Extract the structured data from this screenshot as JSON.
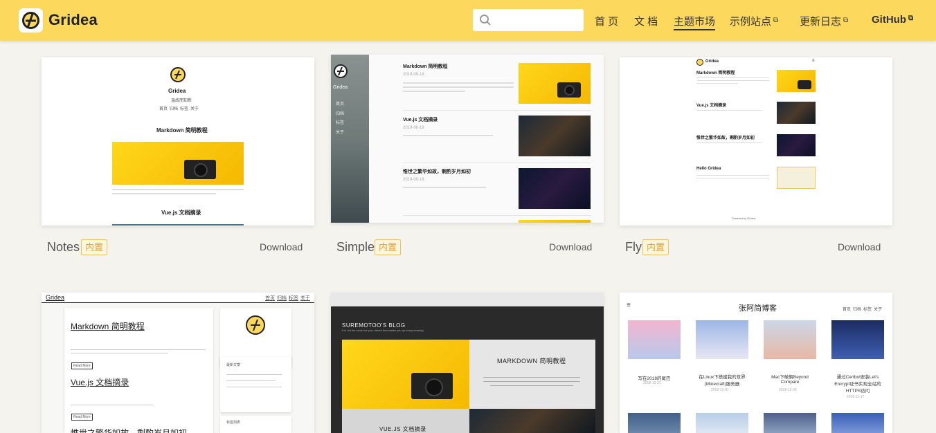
{
  "header": {
    "brand": "Gridea",
    "search_placeholder": "",
    "nav": [
      {
        "label": "首 页",
        "external": false,
        "active": false
      },
      {
        "label": "文 档",
        "external": false,
        "active": false
      },
      {
        "label": "主题市场",
        "external": false,
        "active": true
      },
      {
        "label": "示例站点",
        "external": true,
        "active": false
      },
      {
        "label": "更新日志",
        "external": true,
        "active": false
      },
      {
        "label": "GitHub",
        "external": true,
        "active": false
      }
    ]
  },
  "themes": [
    {
      "name": "Notes",
      "badge": "内置",
      "action": "Download"
    },
    {
      "name": "Simple",
      "badge": "内置",
      "action": "Download"
    },
    {
      "name": "Fly",
      "badge": "内置",
      "action": "Download"
    }
  ],
  "previews": {
    "notes": {
      "brand": "Gridea",
      "desc": "温故而知新",
      "nav": [
        "首页",
        "归档",
        "标签",
        "关于"
      ],
      "post1": "Markdown 简明教程",
      "post2": "Vue.js 文档摘录"
    },
    "simple": {
      "brand": "Gridea",
      "nav": [
        "首页",
        "归档",
        "标签",
        "关于"
      ],
      "post1": "Markdown 简明教程",
      "post2": "Vue.js 文档摘录",
      "post3": "惟世之繁华如故，剩酌岁月如初",
      "date": "2019-06-18"
    },
    "fly": {
      "brand": "Gridea",
      "post1": "Markdown 简明教程",
      "post2": "Vue.js 文档摘录",
      "post3": "惟世之繁华如故，剩酌岁月如初",
      "post4": "Hello Gridea",
      "footer": "Powered by Gridea"
    },
    "hand": {
      "brand": "Gridea",
      "nav": [
        "首页",
        "归档",
        "标签",
        "关于"
      ],
      "post1": "Markdown 简明教程",
      "post2": "Vue.js 文档摘录",
      "post3": "惟世之繁华如故，剩酌岁月如初",
      "read_more": "Read More",
      "side_title": "最新文章",
      "tags_title": "标签列表"
    },
    "suremotoo": {
      "brand": "SUREMOTOO'S BLOG",
      "tagline": "It is not the clock but your dream that wakes you up every morning",
      "post1": "MARKDOWN 简明教程",
      "post2": "VUE.JS 文档摘录"
    },
    "zhang": {
      "brand": "张阿简博客",
      "nav": [
        "首页",
        "归档",
        "标签",
        "关于"
      ],
      "posts": [
        "写在2018的尾巴",
        "在Linux下搭建我的世界(Minecraft)服务器",
        "Mac下破解Beyond Compare",
        "通过Certbot安装Let's Encrypt证书实现全站的HTTPS访问"
      ],
      "dates": [
        "2018-12-31",
        "2018-12-01",
        "2018-12-06",
        "2018-11-17"
      ]
    }
  },
  "colors": {
    "header_bg": "#fcd85c",
    "page_bg": "#f5f3ee",
    "badge_text": "#e2a63b"
  }
}
